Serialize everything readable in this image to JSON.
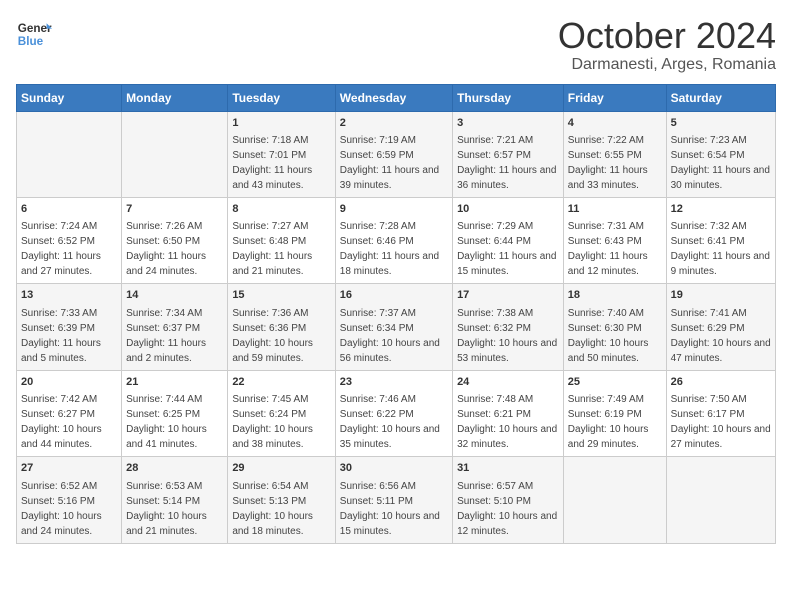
{
  "header": {
    "logo_line1": "General",
    "logo_line2": "Blue",
    "month": "October 2024",
    "location": "Darmanesti, Arges, Romania"
  },
  "days_of_week": [
    "Sunday",
    "Monday",
    "Tuesday",
    "Wednesday",
    "Thursday",
    "Friday",
    "Saturday"
  ],
  "weeks": [
    [
      {
        "num": "",
        "detail": ""
      },
      {
        "num": "",
        "detail": ""
      },
      {
        "num": "1",
        "detail": "Sunrise: 7:18 AM\nSunset: 7:01 PM\nDaylight: 11 hours and 43 minutes."
      },
      {
        "num": "2",
        "detail": "Sunrise: 7:19 AM\nSunset: 6:59 PM\nDaylight: 11 hours and 39 minutes."
      },
      {
        "num": "3",
        "detail": "Sunrise: 7:21 AM\nSunset: 6:57 PM\nDaylight: 11 hours and 36 minutes."
      },
      {
        "num": "4",
        "detail": "Sunrise: 7:22 AM\nSunset: 6:55 PM\nDaylight: 11 hours and 33 minutes."
      },
      {
        "num": "5",
        "detail": "Sunrise: 7:23 AM\nSunset: 6:54 PM\nDaylight: 11 hours and 30 minutes."
      }
    ],
    [
      {
        "num": "6",
        "detail": "Sunrise: 7:24 AM\nSunset: 6:52 PM\nDaylight: 11 hours and 27 minutes."
      },
      {
        "num": "7",
        "detail": "Sunrise: 7:26 AM\nSunset: 6:50 PM\nDaylight: 11 hours and 24 minutes."
      },
      {
        "num": "8",
        "detail": "Sunrise: 7:27 AM\nSunset: 6:48 PM\nDaylight: 11 hours and 21 minutes."
      },
      {
        "num": "9",
        "detail": "Sunrise: 7:28 AM\nSunset: 6:46 PM\nDaylight: 11 hours and 18 minutes."
      },
      {
        "num": "10",
        "detail": "Sunrise: 7:29 AM\nSunset: 6:44 PM\nDaylight: 11 hours and 15 minutes."
      },
      {
        "num": "11",
        "detail": "Sunrise: 7:31 AM\nSunset: 6:43 PM\nDaylight: 11 hours and 12 minutes."
      },
      {
        "num": "12",
        "detail": "Sunrise: 7:32 AM\nSunset: 6:41 PM\nDaylight: 11 hours and 9 minutes."
      }
    ],
    [
      {
        "num": "13",
        "detail": "Sunrise: 7:33 AM\nSunset: 6:39 PM\nDaylight: 11 hours and 5 minutes."
      },
      {
        "num": "14",
        "detail": "Sunrise: 7:34 AM\nSunset: 6:37 PM\nDaylight: 11 hours and 2 minutes."
      },
      {
        "num": "15",
        "detail": "Sunrise: 7:36 AM\nSunset: 6:36 PM\nDaylight: 10 hours and 59 minutes."
      },
      {
        "num": "16",
        "detail": "Sunrise: 7:37 AM\nSunset: 6:34 PM\nDaylight: 10 hours and 56 minutes."
      },
      {
        "num": "17",
        "detail": "Sunrise: 7:38 AM\nSunset: 6:32 PM\nDaylight: 10 hours and 53 minutes."
      },
      {
        "num": "18",
        "detail": "Sunrise: 7:40 AM\nSunset: 6:30 PM\nDaylight: 10 hours and 50 minutes."
      },
      {
        "num": "19",
        "detail": "Sunrise: 7:41 AM\nSunset: 6:29 PM\nDaylight: 10 hours and 47 minutes."
      }
    ],
    [
      {
        "num": "20",
        "detail": "Sunrise: 7:42 AM\nSunset: 6:27 PM\nDaylight: 10 hours and 44 minutes."
      },
      {
        "num": "21",
        "detail": "Sunrise: 7:44 AM\nSunset: 6:25 PM\nDaylight: 10 hours and 41 minutes."
      },
      {
        "num": "22",
        "detail": "Sunrise: 7:45 AM\nSunset: 6:24 PM\nDaylight: 10 hours and 38 minutes."
      },
      {
        "num": "23",
        "detail": "Sunrise: 7:46 AM\nSunset: 6:22 PM\nDaylight: 10 hours and 35 minutes."
      },
      {
        "num": "24",
        "detail": "Sunrise: 7:48 AM\nSunset: 6:21 PM\nDaylight: 10 hours and 32 minutes."
      },
      {
        "num": "25",
        "detail": "Sunrise: 7:49 AM\nSunset: 6:19 PM\nDaylight: 10 hours and 29 minutes."
      },
      {
        "num": "26",
        "detail": "Sunrise: 7:50 AM\nSunset: 6:17 PM\nDaylight: 10 hours and 27 minutes."
      }
    ],
    [
      {
        "num": "27",
        "detail": "Sunrise: 6:52 AM\nSunset: 5:16 PM\nDaylight: 10 hours and 24 minutes."
      },
      {
        "num": "28",
        "detail": "Sunrise: 6:53 AM\nSunset: 5:14 PM\nDaylight: 10 hours and 21 minutes."
      },
      {
        "num": "29",
        "detail": "Sunrise: 6:54 AM\nSunset: 5:13 PM\nDaylight: 10 hours and 18 minutes."
      },
      {
        "num": "30",
        "detail": "Sunrise: 6:56 AM\nSunset: 5:11 PM\nDaylight: 10 hours and 15 minutes."
      },
      {
        "num": "31",
        "detail": "Sunrise: 6:57 AM\nSunset: 5:10 PM\nDaylight: 10 hours and 12 minutes."
      },
      {
        "num": "",
        "detail": ""
      },
      {
        "num": "",
        "detail": ""
      }
    ]
  ]
}
